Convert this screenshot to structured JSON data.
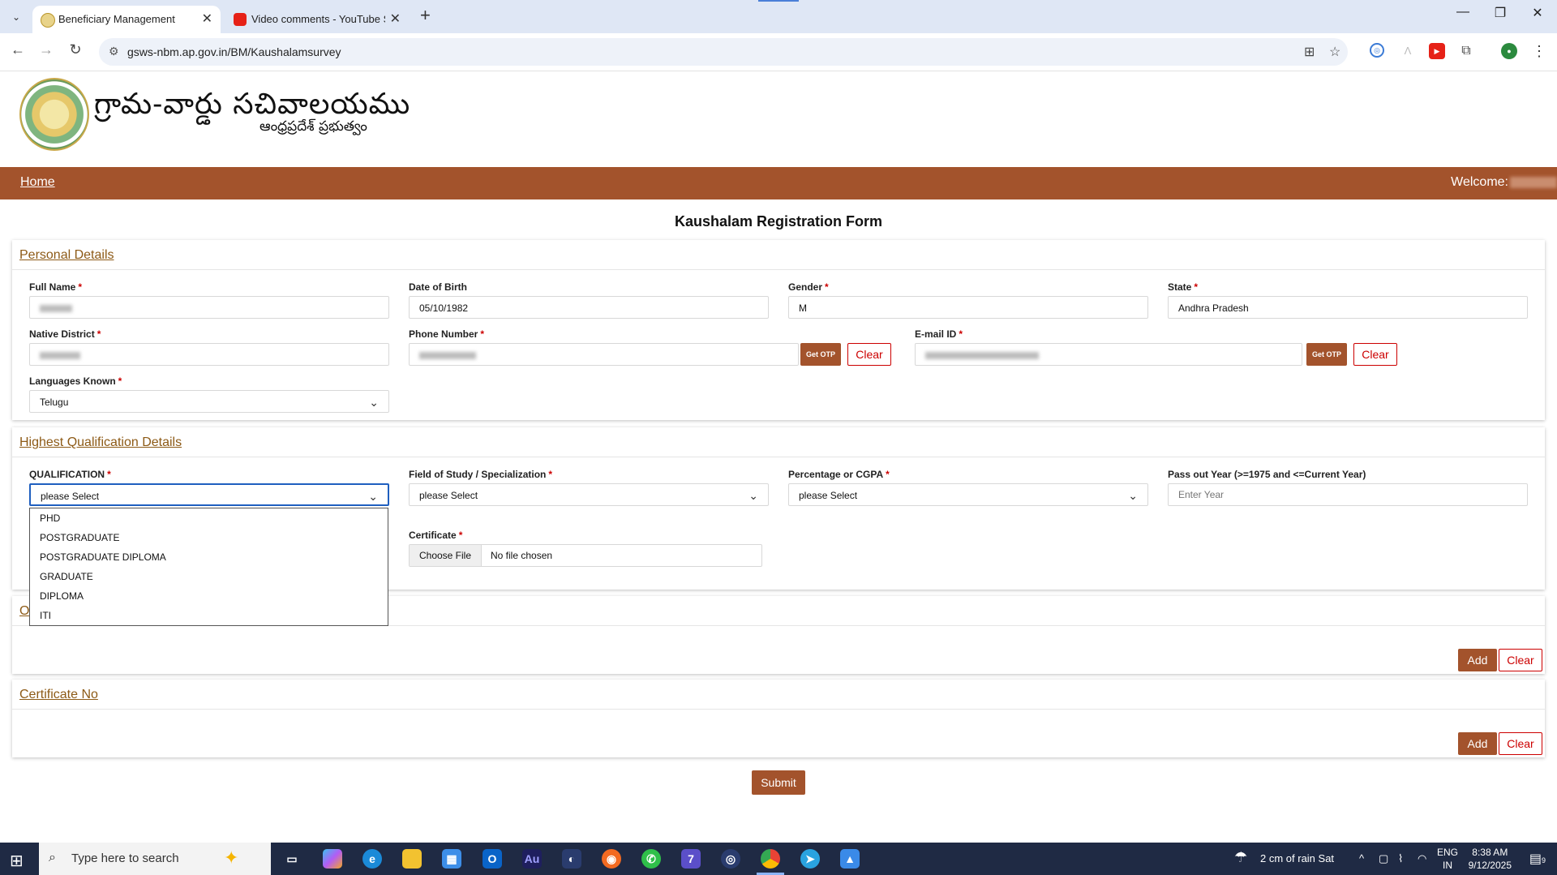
{
  "browser": {
    "tabs": [
      {
        "title": "Beneficiary Management",
        "active": true
      },
      {
        "title": "Video comments - YouTube Studio",
        "active": false
      }
    ],
    "url": "gsws-nbm.ap.gov.in/BM/Kaushalamsurvey"
  },
  "header": {
    "logo_title": "గ్రామ-వార్డు సచివాలయము",
    "logo_subtitle": "ఆంధ్రప్రదేశ్ ప్రభుత్వం"
  },
  "nav": {
    "home": "Home",
    "welcome": "Welcome:"
  },
  "form": {
    "title": "Kaushalam Registration Form",
    "personal": {
      "legend": "Personal Details",
      "full_name_label": "Full Name",
      "dob_label": "Date of Birth",
      "dob_value": "05/10/1982",
      "gender_label": "Gender",
      "gender_value": "M",
      "state_label": "State",
      "state_value": "Andhra Pradesh",
      "district_label": "Native District",
      "phone_label": "Phone Number",
      "email_label": "E-mail ID",
      "get_otp": "Get OTP",
      "clear": "Clear",
      "languages_label": "Languages Known",
      "languages_value": "Telugu"
    },
    "qualification": {
      "legend": "Highest Qualification Details",
      "qualification_label": "QUALIFICATION",
      "qualification_value": "please Select",
      "field_label": "Field of Study / Specialization",
      "field_value": "please Select",
      "percentage_label": "Percentage or CGPA",
      "percentage_value": "please Select",
      "passout_label": "Pass out Year (>=1975 and <=Current Year)",
      "passout_placeholder": "Enter Year",
      "certificate_label": "Certificate",
      "choose_file": "Choose File",
      "no_file": "No file chosen",
      "options": [
        "PHD",
        "POSTGRADUATE",
        "POSTGRADUATE DIPLOMA",
        "GRADUATE",
        "DIPLOMA",
        "ITI"
      ]
    },
    "other_section": {
      "legend_partial": "O",
      "add": "Add",
      "clear": "Clear"
    },
    "certificate_no": {
      "legend": "Certificate No",
      "add": "Add",
      "clear": "Clear"
    },
    "submit": "Submit"
  },
  "taskbar": {
    "search_placeholder": "Type here to search",
    "weather": "2 cm of rain Sat",
    "lang_1": "ENG",
    "lang_2": "IN",
    "time": "8:38 AM",
    "date": "9/12/2025",
    "notification_count": "9"
  },
  "colors": {
    "brand": "#a3532c",
    "legend": "#8d5a16",
    "danger": "#cc0000",
    "focus": "#1f5fbf"
  }
}
